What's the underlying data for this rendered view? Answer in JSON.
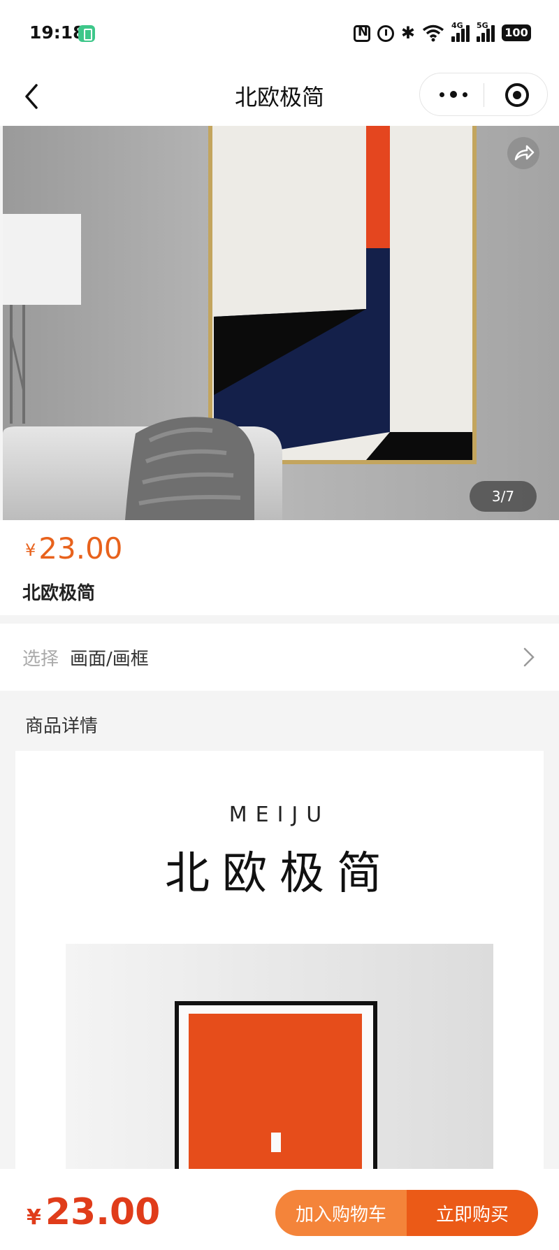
{
  "status_bar": {
    "time": "19:18",
    "signal1_label": "4G",
    "signal2_label": "5G",
    "battery": "100"
  },
  "nav": {
    "title": "北欧极简"
  },
  "gallery": {
    "indicator": "3/7",
    "current": 3,
    "total": 7
  },
  "product": {
    "currency": "¥",
    "price": "23.00",
    "title": "北欧极简"
  },
  "select": {
    "label": "选择",
    "value": "画面/画框"
  },
  "details": {
    "heading": "商品详情",
    "brand": "MEIJU",
    "title": "北欧极简"
  },
  "bottom_bar": {
    "currency": "¥",
    "price": "23.00",
    "add_to_cart": "加入购物车",
    "buy_now": "立即购买"
  },
  "colors": {
    "accent": "#eb5a17",
    "accent_light": "#f4843a",
    "price": "#e8621c"
  }
}
